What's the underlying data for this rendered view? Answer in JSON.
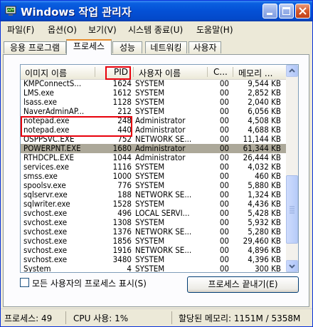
{
  "window": {
    "title": "Windows 작업 관리자"
  },
  "menu": [
    "파일(F)",
    "옵션(O)",
    "보기(V)",
    "시스템 종료(U)",
    "도움말(H)"
  ],
  "tabs": [
    {
      "label": "응용 프로그램",
      "active": false
    },
    {
      "label": "프로세스",
      "active": true
    },
    {
      "label": "성능",
      "active": false
    },
    {
      "label": "네트워킹",
      "active": false
    },
    {
      "label": "사용자",
      "active": false
    }
  ],
  "columns": {
    "name": "이미지 이름",
    "pid": "PID",
    "user": "사용자 이름",
    "cpu": "C...",
    "mem": "메모리 ..."
  },
  "processes": [
    {
      "name": "KMPConnectS...",
      "pid": "1624",
      "user": "SYSTEM",
      "cpu": "00",
      "mem": "9,544 KB"
    },
    {
      "name": "LMS.exe",
      "pid": "1612",
      "user": "SYSTEM",
      "cpu": "00",
      "mem": "2,852 KB"
    },
    {
      "name": "lsass.exe",
      "pid": "1128",
      "user": "SYSTEM",
      "cpu": "00",
      "mem": "2,040 KB"
    },
    {
      "name": "NaverAdminAP...",
      "pid": "212",
      "user": "SYSTEM",
      "cpu": "00",
      "mem": "6,056 KB"
    },
    {
      "name": "notepad.exe",
      "pid": "248",
      "user": "Administrator",
      "cpu": "00",
      "mem": "4,508 KB"
    },
    {
      "name": "notepad.exe",
      "pid": "440",
      "user": "Administrator",
      "cpu": "00",
      "mem": "4,688 KB"
    },
    {
      "name": "OSPPSVC.EXE",
      "pid": "752",
      "user": "NETWORK SE...",
      "cpu": "00",
      "mem": "11,144 KB"
    },
    {
      "name": "POWERPNT.EXE",
      "pid": "1680",
      "user": "Administrator",
      "cpu": "00",
      "mem": "61,344 KB"
    },
    {
      "name": "RTHDCPL.EXE",
      "pid": "1044",
      "user": "Administrator",
      "cpu": "00",
      "mem": "26,444 KB"
    },
    {
      "name": "services.exe",
      "pid": "1116",
      "user": "SYSTEM",
      "cpu": "00",
      "mem": "4,032 KB"
    },
    {
      "name": "smss.exe",
      "pid": "1000",
      "user": "SYSTEM",
      "cpu": "00",
      "mem": "460 KB"
    },
    {
      "name": "spoolsv.exe",
      "pid": "776",
      "user": "SYSTEM",
      "cpu": "00",
      "mem": "5,880 KB"
    },
    {
      "name": "sqlservr.exe",
      "pid": "188",
      "user": "NETWORK SE...",
      "cpu": "00",
      "mem": "1,324 KB"
    },
    {
      "name": "sqlwriter.exe",
      "pid": "1528",
      "user": "SYSTEM",
      "cpu": "00",
      "mem": "4,436 KB"
    },
    {
      "name": "svchost.exe",
      "pid": "496",
      "user": "LOCAL SERVI...",
      "cpu": "00",
      "mem": "5,428 KB"
    },
    {
      "name": "svchost.exe",
      "pid": "1308",
      "user": "SYSTEM",
      "cpu": "00",
      "mem": "5,932 KB"
    },
    {
      "name": "svchost.exe",
      "pid": "1376",
      "user": "NETWORK SE...",
      "cpu": "00",
      "mem": "5,280 KB"
    },
    {
      "name": "svchost.exe",
      "pid": "1856",
      "user": "SYSTEM",
      "cpu": "00",
      "mem": "29,460 KB"
    },
    {
      "name": "svchost.exe",
      "pid": "1916",
      "user": "NETWORK SE...",
      "cpu": "00",
      "mem": "4,896 KB"
    },
    {
      "name": "svchost.exe",
      "pid": "3480",
      "user": "SYSTEM",
      "cpu": "00",
      "mem": "4,396 KB"
    },
    {
      "name": "System",
      "pid": "4",
      "user": "SYSTEM",
      "cpu": "00",
      "mem": "300 KB"
    }
  ],
  "selected_process": "POWERPNT.EXE",
  "show_all_users": {
    "label": "모든 사용자의 프로세스 표시(S)",
    "checked": false
  },
  "end_process_button": "프로세스 끝내기(E)",
  "status": {
    "processes": "프로세스: 49",
    "cpu": "CPU 사용: 1%",
    "commit": "할당된 메모리: 1151M / 5358M"
  },
  "colors": {
    "title_bar": "#0450d5",
    "highlight_box": "#e8000b",
    "selection": "#aca899",
    "tab_accent": "#e68b2c"
  },
  "icons": {
    "app": "task-manager-icon",
    "minimize": "minimize-icon",
    "maximize": "maximize-icon",
    "close": "close-icon"
  }
}
